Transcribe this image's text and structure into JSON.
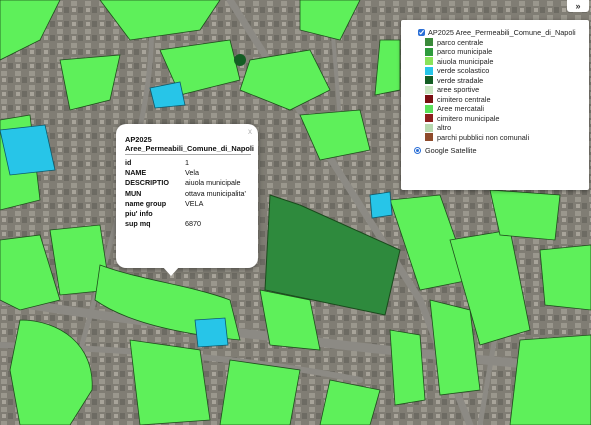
{
  "popup": {
    "close_label": "x",
    "layer_name": "AP2025\nAree_Permeabili_Comune_di_Napoli",
    "layer_line1": "AP2025",
    "layer_line2": "Aree_Permeabili_Comune_di_Napoli",
    "attributes": [
      {
        "key": "id",
        "value": "1"
      },
      {
        "key": "NAME",
        "value": "Vela"
      },
      {
        "key": "DESCRIPTIO",
        "value": "aiuola municipale"
      },
      {
        "key": "MUN",
        "value": "ottava municipalita'"
      },
      {
        "key": "name group",
        "value": "VELA"
      },
      {
        "key": "piu' info",
        "value": ""
      },
      {
        "key": "sup mq",
        "value": "6870"
      }
    ]
  },
  "layer_control": {
    "toggle_label": "»",
    "overlay": {
      "name": "AP2025 Aree_Permeabili_Comune_di_Napoli",
      "checked": true
    },
    "legend": [
      {
        "label": "parco centrale",
        "color": "#3a8a3a"
      },
      {
        "label": "parco municipale",
        "color": "#2e9b3d"
      },
      {
        "label": "aiuola municipale",
        "color": "#8ae35a"
      },
      {
        "label": "verde scolastico",
        "color": "#27c5e8"
      },
      {
        "label": "verde stradale",
        "color": "#145e24"
      },
      {
        "label": "aree sportive",
        "color": "#c8e6c1"
      },
      {
        "label": "cimitero centrale",
        "color": "#7a0f12"
      },
      {
        "label": "Aree mercatali",
        "color": "#5ae05a"
      },
      {
        "label": "cimitero municipale",
        "color": "#8e1e1e"
      },
      {
        "label": "altro",
        "color": "#b8d9b0"
      },
      {
        "label": "parchi pubblici non comunali",
        "color": "#8f4b2b"
      }
    ],
    "basemap": {
      "name": "Google Satellite",
      "selected": true
    }
  },
  "colors": {
    "green_area": "#5ef05a",
    "dark_green": "#2e8a3d",
    "school_cyan": "#27c5e8"
  }
}
